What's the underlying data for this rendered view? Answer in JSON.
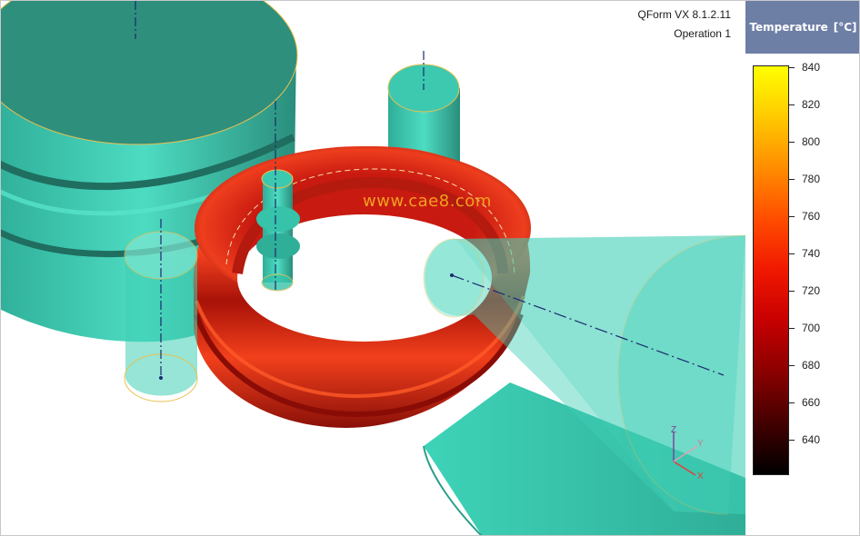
{
  "app_version": "QForm VX 8.1.2.11",
  "operation": "Operation 1",
  "watermark": "www.cae8.com",
  "legend": {
    "title": "Temperature",
    "unit": "[°C]",
    "ticks": [
      {
        "label": "840",
        "value": 840
      },
      {
        "label": "820",
        "value": 820
      },
      {
        "label": "800",
        "value": 800
      },
      {
        "label": "780",
        "value": 780
      },
      {
        "label": "760",
        "value": 760
      },
      {
        "label": "740",
        "value": 740
      },
      {
        "label": "720",
        "value": 720
      },
      {
        "label": "700",
        "value": 700
      },
      {
        "label": "680",
        "value": 680
      },
      {
        "label": "660",
        "value": 660
      },
      {
        "label": "640",
        "value": 640
      }
    ],
    "colors": [
      "#ffff00",
      "#ff8c00",
      "#f01800",
      "#8a0000",
      "#000000"
    ]
  },
  "axes": {
    "x": "X",
    "y": "Y",
    "z": "Z"
  },
  "colors": {
    "tool": "#3fcfb5",
    "tool_dark": "#2e8f7d",
    "workpiece": "#e0341a",
    "outline": "#e8c050",
    "axis_line": "#1b2a70",
    "legend_header": "#6e7fa6"
  }
}
